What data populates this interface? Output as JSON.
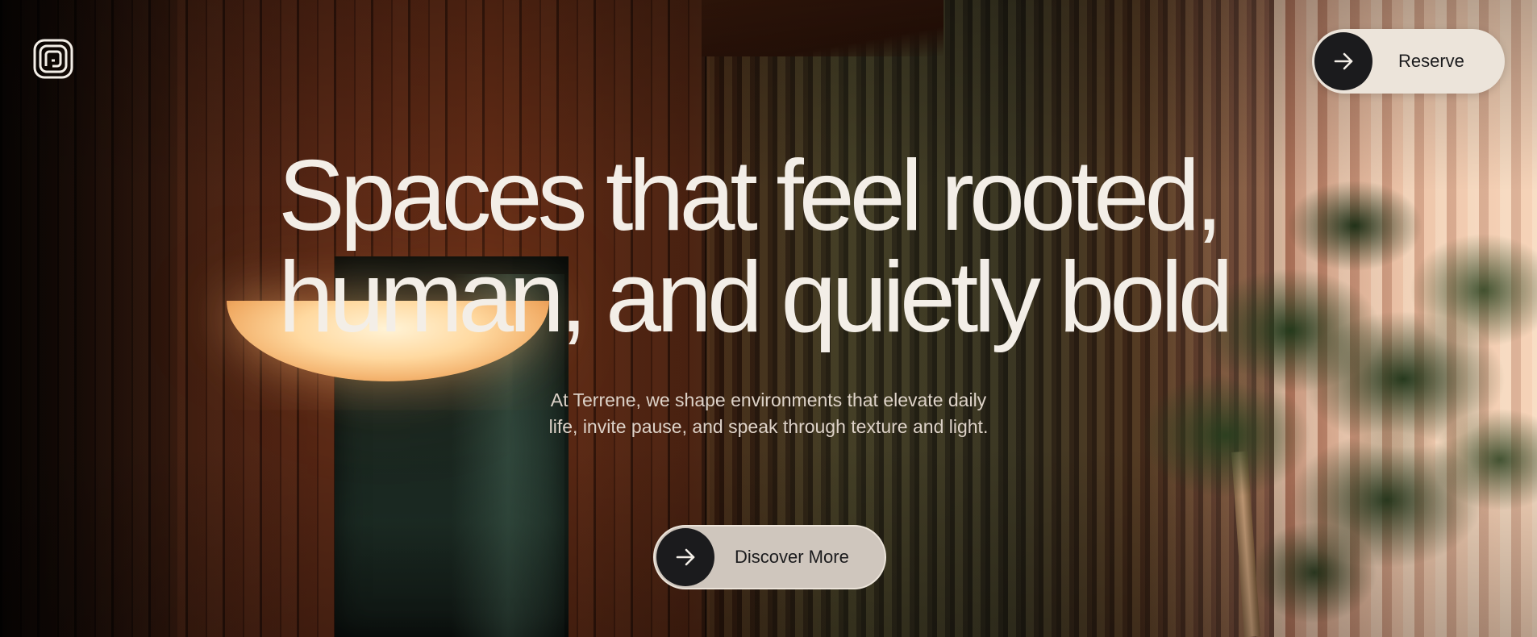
{
  "brand": {
    "logo_icon": "concentric-square-logo-icon"
  },
  "nav": {
    "reserve_label": "Reserve",
    "reserve_icon": "arrow-right-icon"
  },
  "hero": {
    "headline_line1": "Spaces that feel rooted,",
    "headline_line2": "human, and quietly bold",
    "subtitle": "At Terrene, we shape environments that elevate daily life, invite pause, and speak through texture and light.",
    "cta_label": "Discover More",
    "cta_icon": "arrow-right-icon"
  },
  "colors": {
    "headline_text": "#f3eee7",
    "button_light": "#ece4da",
    "button_dark": "#1b1b1d"
  }
}
